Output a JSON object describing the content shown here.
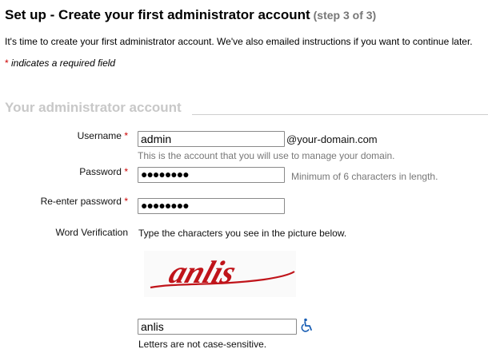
{
  "header": {
    "title": "Set up - Create your first administrator account",
    "step": "(step 3 of 3)"
  },
  "intro_text": "It's time to create your first administrator account. We've also emailed instructions if you want to continue later.",
  "required_note": {
    "star": "*",
    "text": " indicates a required field"
  },
  "section": {
    "title": "Your administrator account"
  },
  "form": {
    "username": {
      "label": "Username",
      "star": "*",
      "value": "admin",
      "suffix": "@your-domain.com",
      "hint": "This is the account that you will use to manage your domain."
    },
    "password": {
      "label": "Password",
      "star": "*",
      "masked": "●●●●●●●●",
      "hint": "Minimum of 6 characters in length."
    },
    "password_confirm": {
      "label": "Re-enter password",
      "star": "*",
      "masked": "●●●●●●●●"
    },
    "verification": {
      "label": "Word Verification",
      "instructions": "Type the characters you see in the picture below.",
      "captcha_text": "anlis",
      "value": "anlis",
      "note": "Letters are not case-sensitive.",
      "audio_icon": "wheelchair-accessibility-icon"
    }
  },
  "colors": {
    "required_star": "#cc0000",
    "section_title": "#c8c8c8",
    "captcha": "#c0141a",
    "accessibility_icon": "#1a5fb4"
  }
}
